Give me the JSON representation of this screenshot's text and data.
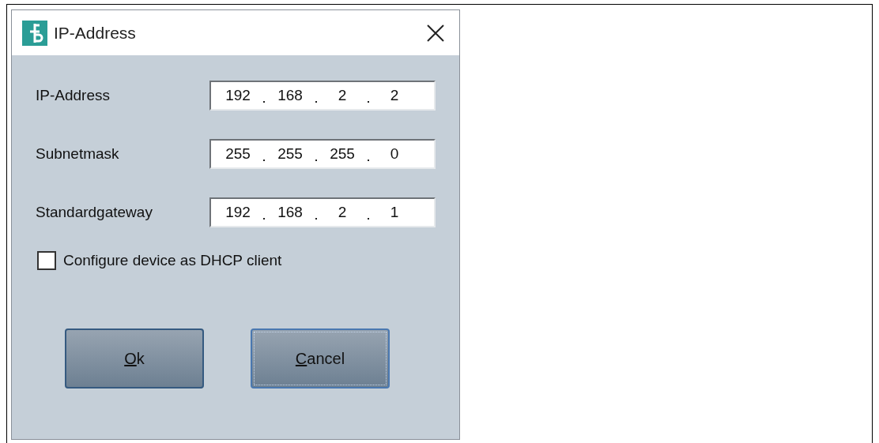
{
  "window": {
    "title": "IP-Address"
  },
  "fields": [
    {
      "label": "IP-Address",
      "octets": [
        "192",
        "168",
        "2",
        "2"
      ]
    },
    {
      "label": "Subnetmask",
      "octets": [
        "255",
        "255",
        "255",
        "0"
      ]
    },
    {
      "label": "Standardgateway",
      "octets": [
        "192",
        "168",
        "2",
        "1"
      ]
    }
  ],
  "checkbox": {
    "label": "Configure device as DHCP client",
    "checked": false
  },
  "buttons": [
    {
      "label": "Ok",
      "mnemonic": true,
      "focused": false
    },
    {
      "label": "Cancel",
      "mnemonic": true,
      "focused": true
    }
  ]
}
